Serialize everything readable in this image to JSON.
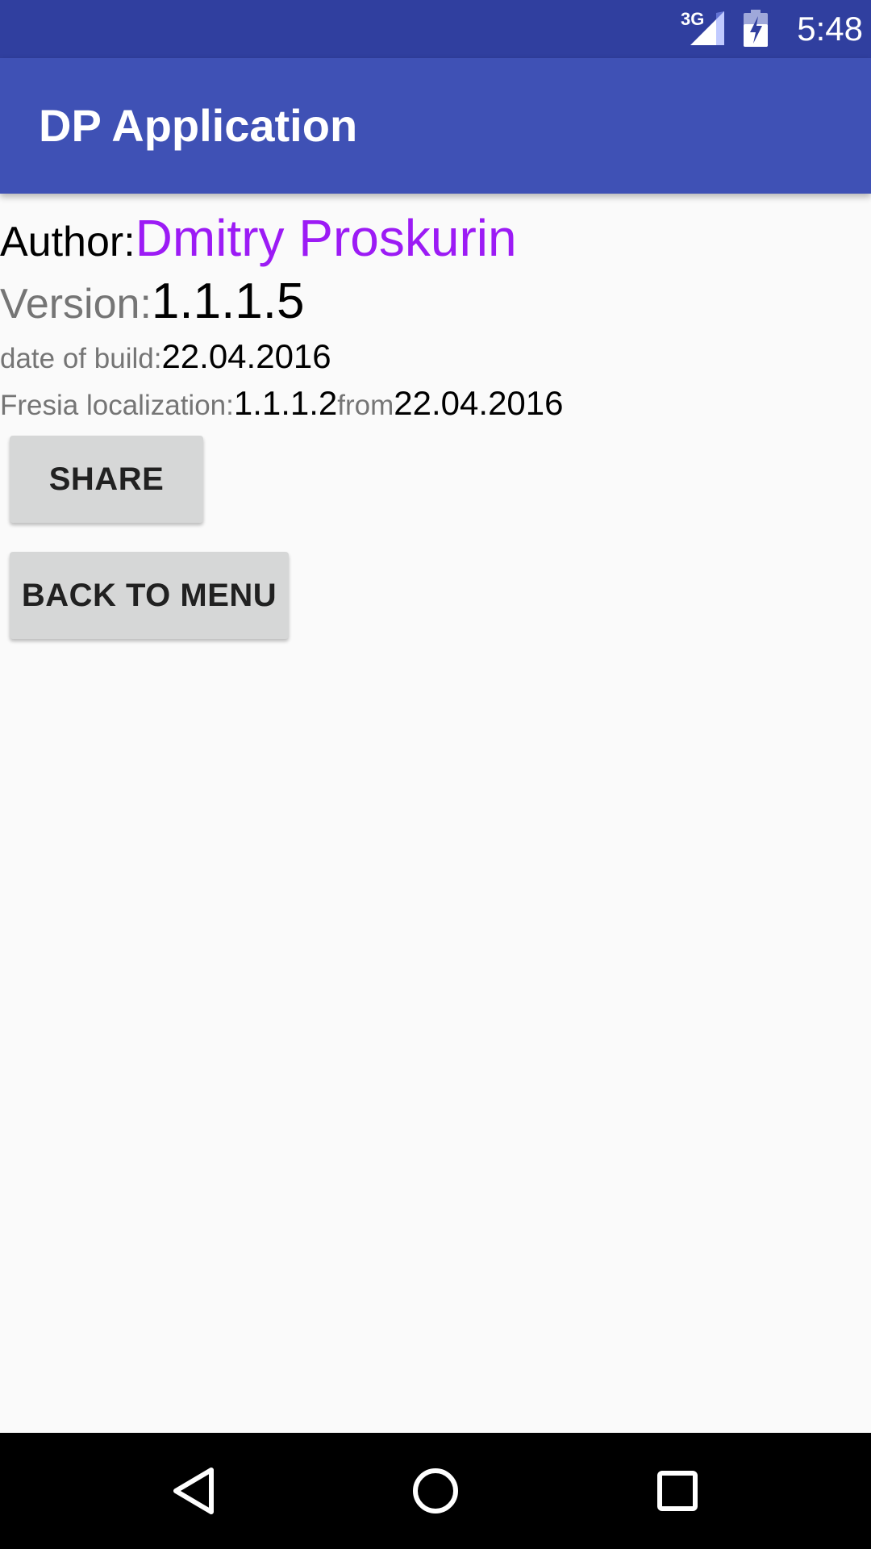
{
  "status_bar": {
    "network_label": "3G",
    "time": "5:48",
    "background_color": "#303f9f",
    "icons": [
      "network-signal-icon",
      "battery-charging-icon"
    ]
  },
  "app_bar": {
    "title": "DP Application",
    "background_color": "#3f51b5"
  },
  "info": {
    "author_label": "Author:",
    "author_name": "Dmitry Proskurin",
    "author_color": "#9c1bf5",
    "version_label": "Version:",
    "version_value": "1.1.1.5",
    "build_date_label": "date of build:",
    "build_date_value": "22.04.2016",
    "localization_label": "Fresia localization:",
    "localization_version": "1.1.1.2",
    "localization_from_label": "from",
    "localization_date": "22.04.2016"
  },
  "buttons": {
    "share": "SHARE",
    "back_to_menu": "BACK TO MENU"
  },
  "nav_bar": {
    "icons": [
      "back-icon",
      "home-icon",
      "recents-icon"
    ]
  }
}
